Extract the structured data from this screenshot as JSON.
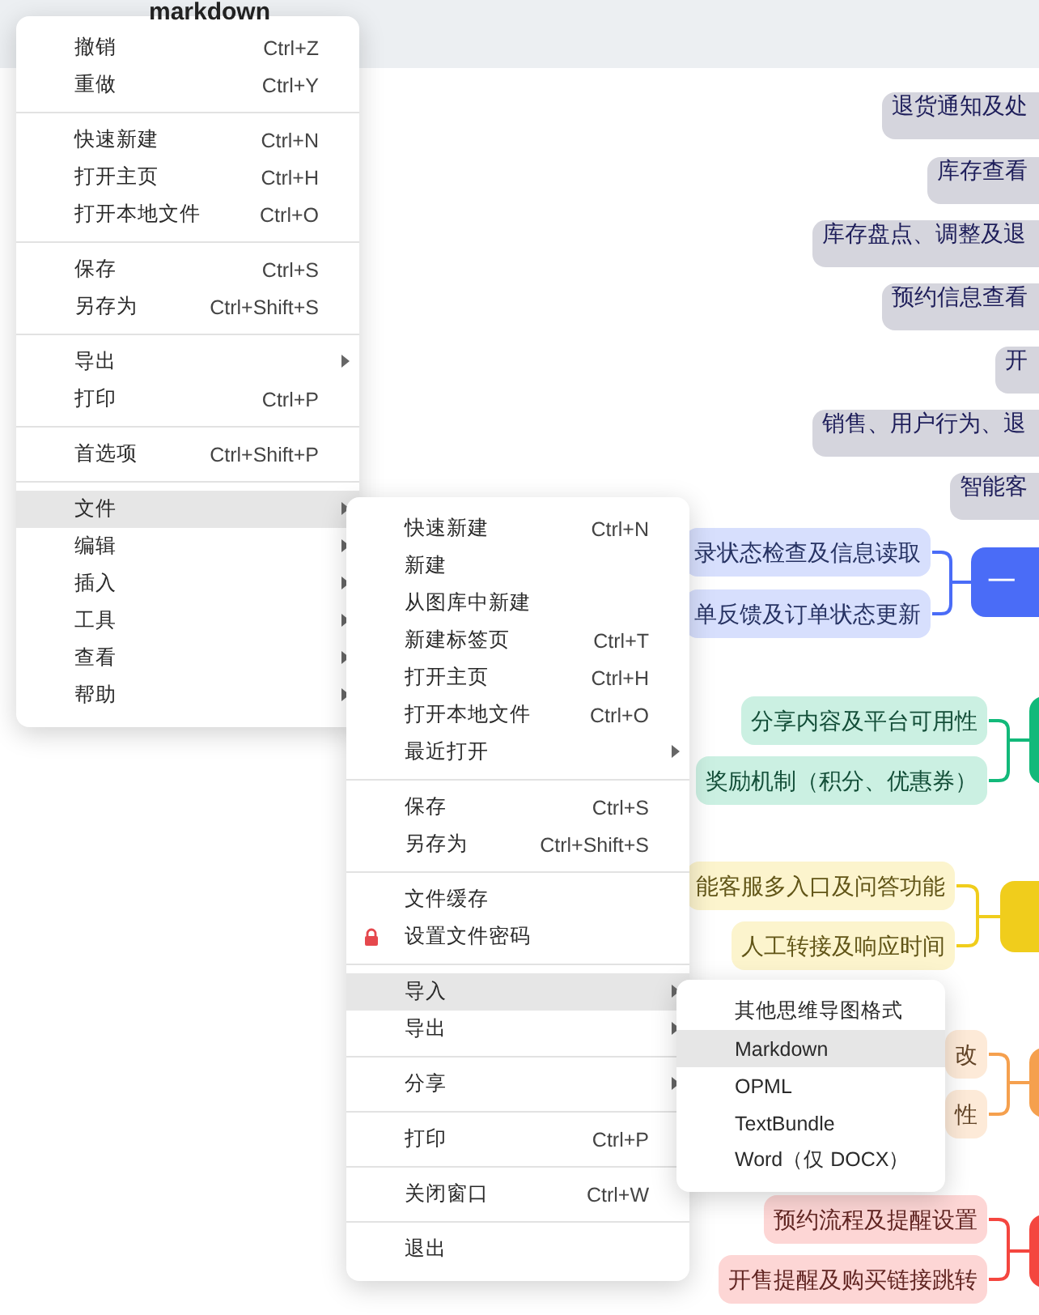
{
  "window": {
    "title": "markdown"
  },
  "menus": [
    {
      "sections": [
        {
          "items": [
            {
              "label": "撤销",
              "shortcut": "Ctrl+Z",
              "submenu": false,
              "selected": false
            },
            {
              "label": "重做",
              "shortcut": "Ctrl+Y",
              "submenu": false,
              "selected": false
            }
          ]
        },
        {
          "items": [
            {
              "label": "快速新建",
              "shortcut": "Ctrl+N",
              "submenu": false,
              "selected": false
            },
            {
              "label": "打开主页",
              "shortcut": "Ctrl+H",
              "submenu": false,
              "selected": false
            },
            {
              "label": "打开本地文件",
              "shortcut": "Ctrl+O",
              "submenu": false,
              "selected": false
            }
          ]
        },
        {
          "items": [
            {
              "label": "保存",
              "shortcut": "Ctrl+S",
              "submenu": false,
              "selected": false
            },
            {
              "label": "另存为",
              "shortcut": "Ctrl+Shift+S",
              "submenu": false,
              "selected": false
            }
          ]
        },
        {
          "items": [
            {
              "label": "导出",
              "submenu": true,
              "selected": false
            },
            {
              "label": "打印",
              "shortcut": "Ctrl+P",
              "submenu": false,
              "selected": false
            }
          ]
        },
        {
          "items": [
            {
              "label": "首选项",
              "shortcut": "Ctrl+Shift+P",
              "submenu": false,
              "selected": false
            }
          ]
        },
        {
          "items": [
            {
              "label": "文件",
              "submenu": true,
              "selected": true
            },
            {
              "label": "编辑",
              "submenu": true,
              "selected": false
            },
            {
              "label": "插入",
              "submenu": true,
              "selected": false
            },
            {
              "label": "工具",
              "submenu": true,
              "selected": false
            },
            {
              "label": "查看",
              "submenu": true,
              "selected": false
            },
            {
              "label": "帮助",
              "submenu": true,
              "selected": false
            }
          ]
        }
      ]
    },
    {
      "sections": [
        {
          "items": [
            {
              "label": "快速新建",
              "shortcut": "Ctrl+N",
              "submenu": false,
              "selected": false
            },
            {
              "label": "新建",
              "submenu": false,
              "selected": false
            },
            {
              "label": "从图库中新建",
              "submenu": false,
              "selected": false
            },
            {
              "label": "新建标签页",
              "shortcut": "Ctrl+T",
              "submenu": false,
              "selected": false
            },
            {
              "label": "打开主页",
              "shortcut": "Ctrl+H",
              "submenu": false,
              "selected": false
            },
            {
              "label": "打开本地文件",
              "shortcut": "Ctrl+O",
              "submenu": false,
              "selected": false
            },
            {
              "label": "最近打开",
              "submenu": true,
              "selected": false
            }
          ]
        },
        {
          "items": [
            {
              "label": "保存",
              "shortcut": "Ctrl+S",
              "submenu": false,
              "selected": false
            },
            {
              "label": "另存为",
              "shortcut": "Ctrl+Shift+S",
              "submenu": false,
              "selected": false
            }
          ]
        },
        {
          "items": [
            {
              "label": "文件缓存",
              "submenu": false,
              "selected": false
            },
            {
              "label": "设置文件密码",
              "locked": true,
              "submenu": false,
              "selected": false
            }
          ]
        },
        {
          "items": [
            {
              "label": "导入",
              "submenu": true,
              "selected": true
            },
            {
              "label": "导出",
              "submenu": true,
              "selected": false
            }
          ]
        },
        {
          "items": [
            {
              "label": "分享",
              "submenu": true,
              "selected": false
            }
          ]
        },
        {
          "items": [
            {
              "label": "打印",
              "shortcut": "Ctrl+P",
              "submenu": false,
              "selected": false
            }
          ]
        },
        {
          "items": [
            {
              "label": "关闭窗口",
              "shortcut": "Ctrl+W",
              "submenu": false,
              "selected": false
            }
          ]
        },
        {
          "items": [
            {
              "label": "退出",
              "submenu": false,
              "selected": false
            }
          ]
        }
      ]
    },
    {
      "sections": [
        {
          "items": [
            {
              "label": "其他思维导图格式",
              "submenu": false,
              "selected": false
            },
            {
              "label": "Markdown",
              "submenu": false,
              "selected": true
            },
            {
              "label": "OPML",
              "submenu": false,
              "selected": false
            },
            {
              "label": "TextBundle",
              "submenu": false,
              "selected": false
            },
            {
              "label": "Word（仅 DOCX）",
              "submenu": false,
              "selected": false
            }
          ]
        }
      ]
    }
  ],
  "mindmap": {
    "nodes": [
      {
        "label": "退货通知及处"
      },
      {
        "label": "库存查看"
      },
      {
        "label": "库存盘点、调整及退"
      },
      {
        "label": "预约信息查看"
      },
      {
        "label": "开"
      },
      {
        "label": "销售、用户行为、退"
      },
      {
        "label": "智能客"
      }
    ],
    "branches": [
      {
        "color": "#4a6cf7",
        "label": "一",
        "children": [
          {
            "label": "录状态检查及信息读取"
          },
          {
            "label": "单反馈及订单状态更新"
          }
        ]
      },
      {
        "color": "#12b97a",
        "children": [
          {
            "label": "分享内容及平台可用性"
          },
          {
            "label": "奖励机制（积分、优惠券）"
          }
        ]
      },
      {
        "color": "#f0cd1c",
        "children": [
          {
            "label": "能客服多入口及问答功能"
          },
          {
            "label": "人工转接及响应时间"
          }
        ]
      },
      {
        "color": "#f5a04e",
        "children": [
          {
            "label": "改"
          },
          {
            "label": "性"
          }
        ]
      },
      {
        "color": "#f4463f",
        "children": [
          {
            "label": "预约流程及提醒设置"
          },
          {
            "label": "开售提醒及购买链接跳转"
          }
        ]
      }
    ]
  }
}
